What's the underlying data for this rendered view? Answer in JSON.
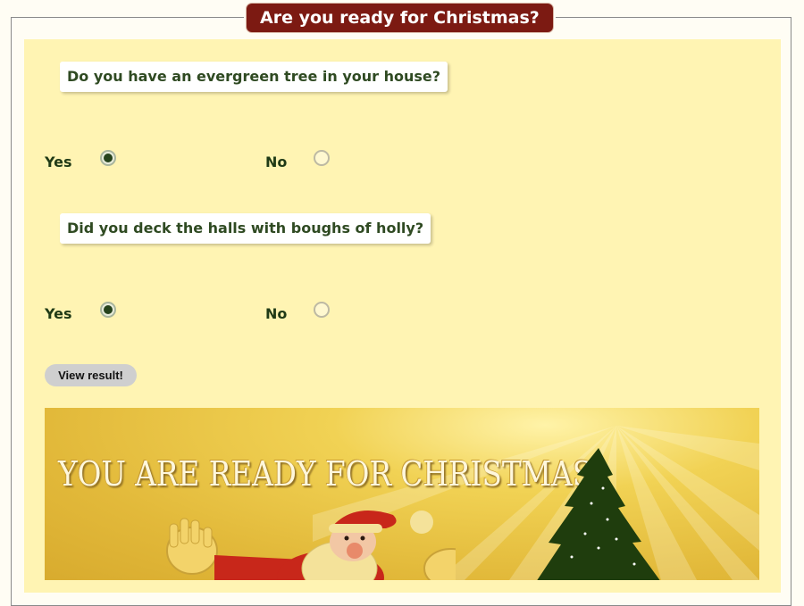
{
  "legend": {
    "title": "Are you ready for Christmas?"
  },
  "questions": [
    {
      "text": "Do you have an evergreen tree in your house?",
      "options": [
        {
          "label": "Yes",
          "checked": true
        },
        {
          "label": "No",
          "checked": false
        }
      ]
    },
    {
      "text": "Did you deck the halls with boughs of holly?",
      "options": [
        {
          "label": "Yes",
          "checked": true
        },
        {
          "label": "No",
          "checked": false
        }
      ]
    }
  ],
  "button": {
    "label": "View result!"
  },
  "result": {
    "banner_text": "YOU ARE READY FOR CHRISTMAS!",
    "image_elements": [
      "santa-illustration",
      "christmas-tree-illustration"
    ]
  },
  "colors": {
    "legend_bg": "#7c1a12",
    "panel_bg": "#fff4b3",
    "question_text": "#2f4a22",
    "radio_dot": "#26431c",
    "tree_green": "#1f3d0d"
  }
}
